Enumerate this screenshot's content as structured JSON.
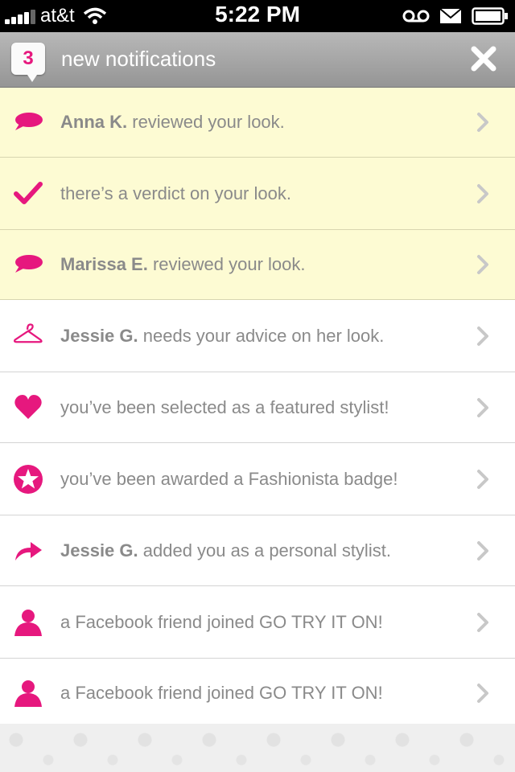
{
  "status_bar": {
    "carrier": "at&t",
    "time": "5:22 PM"
  },
  "header": {
    "count": "3",
    "title": "new notifications"
  },
  "notifications": [
    {
      "icon": "speech-bubble-icon",
      "bold": "Anna K.",
      "text": " reviewed your look.",
      "unread": true
    },
    {
      "icon": "checkmark-icon",
      "bold": "",
      "text": "there’s a verdict on your look.",
      "unread": true
    },
    {
      "icon": "speech-bubble-icon",
      "bold": "Marissa E.",
      "text": " reviewed your look.",
      "unread": true
    },
    {
      "icon": "hanger-icon",
      "bold": "Jessie G.",
      "text": " needs your advice on her look.",
      "unread": false
    },
    {
      "icon": "heart-icon",
      "bold": "",
      "text": "you’ve been selected as a featured stylist!",
      "unread": false
    },
    {
      "icon": "star-badge-icon",
      "bold": "",
      "text": "you’ve been awarded a Fashionista badge!",
      "unread": false
    },
    {
      "icon": "share-arrow-icon",
      "bold": "Jessie G.",
      "text": " added you as a personal stylist.",
      "unread": false
    },
    {
      "icon": "person-icon",
      "bold": "",
      "text": "a Facebook friend joined GO TRY IT ON!",
      "unread": false
    },
    {
      "icon": "person-icon",
      "bold": "",
      "text": "a Facebook friend joined GO TRY IT ON!",
      "unread": false
    }
  ],
  "colors": {
    "accent": "#e6187e",
    "unread_bg": "#fdfbd3",
    "text": "#8a8a8a"
  }
}
